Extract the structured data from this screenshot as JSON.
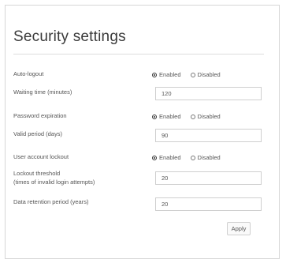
{
  "page": {
    "title": "Security settings"
  },
  "auto_logout": {
    "label": "Auto-logout",
    "options": [
      "Enabled",
      "Disabled"
    ],
    "selected": "Enabled"
  },
  "waiting_time": {
    "label": "Waiting time (minutes)",
    "value": "120"
  },
  "password_expiration": {
    "label": "Password expiration",
    "options": [
      "Enabled",
      "Disabled"
    ],
    "selected": "Enabled"
  },
  "valid_period": {
    "label": "Valid period (days)",
    "value": "90"
  },
  "user_account_lockout": {
    "label": "User account lockout",
    "options": [
      "Enabled",
      "Disabled"
    ],
    "selected": "Enabled"
  },
  "lockout_threshold": {
    "label_line1": "Lockout threshold",
    "label_line2": "(times of invalid login attempts)",
    "value": "20"
  },
  "data_retention": {
    "label": "Data retention period (years)",
    "value": "20"
  },
  "actions": {
    "apply_label": "Apply"
  }
}
